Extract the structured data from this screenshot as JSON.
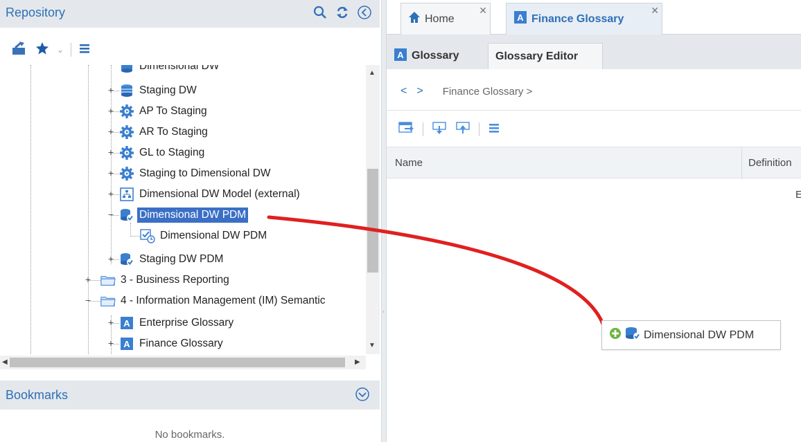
{
  "repository": {
    "title": "Repository",
    "tree": [
      {
        "label": "Dimensional DW",
        "icon": "database-icon"
      },
      {
        "label": "Staging DW",
        "icon": "database-icon"
      },
      {
        "label": "AP To Staging",
        "icon": "gear-icon"
      },
      {
        "label": "AR To Staging",
        "icon": "gear-icon"
      },
      {
        "label": "GL to Staging",
        "icon": "gear-icon"
      },
      {
        "label": "Staging to Dimensional DW",
        "icon": "gear-icon"
      },
      {
        "label": "Dimensional DW Model (external)",
        "icon": "model-icon"
      },
      {
        "label": "Dimensional DW PDM",
        "icon": "pdm-icon",
        "selected": true
      },
      {
        "label": "Dimensional DW PDM",
        "icon": "pdm-version-icon"
      },
      {
        "label": "Staging DW PDM",
        "icon": "pdm-icon"
      },
      {
        "label": "3 - Business Reporting",
        "icon": "folder-icon"
      },
      {
        "label": "4 - Information Management (IM) Semantic",
        "icon": "folder-icon"
      },
      {
        "label": "Enterprise Glossary",
        "icon": "glossary-icon"
      },
      {
        "label": "Finance Glossary",
        "icon": "glossary-icon"
      }
    ]
  },
  "bookmarks": {
    "title": "Bookmarks",
    "empty_text": "No bookmarks."
  },
  "tabs": [
    {
      "label": "Home",
      "icon": "home-icon"
    },
    {
      "label": "Finance Glossary",
      "icon": "glossary-icon",
      "active": true
    }
  ],
  "subtabs": [
    {
      "label": "Glossary",
      "icon": "glossary-icon"
    },
    {
      "label": "Glossary Editor",
      "active": true
    }
  ],
  "breadcrumb": {
    "text": "Finance Glossary >"
  },
  "grid": {
    "columns": [
      "Name",
      "Definition"
    ],
    "stray_text": "E"
  },
  "drag_item": {
    "label": "Dimensional DW PDM"
  },
  "colors": {
    "accent": "#2f6fb6",
    "selection": "#3b6fc6",
    "drag_line": "#e02020"
  }
}
